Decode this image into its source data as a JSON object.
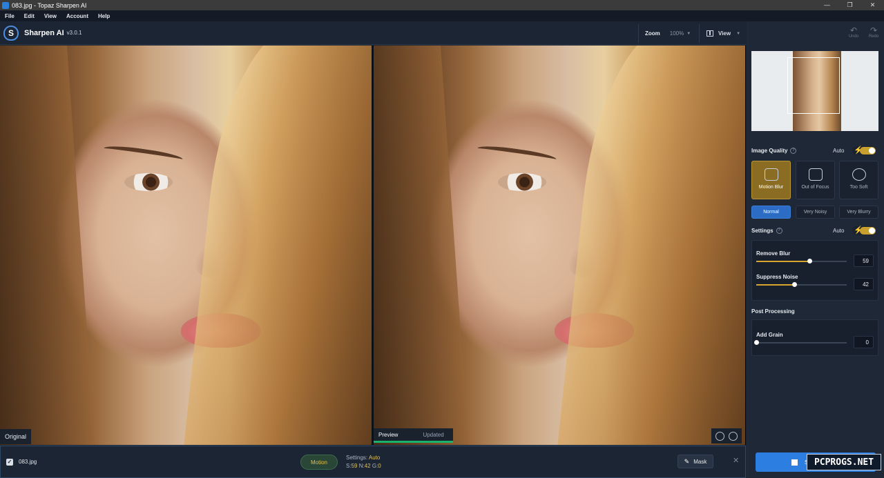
{
  "window": {
    "title": "083.jpg - Topaz Sharpen AI",
    "controls": [
      "—",
      "❐",
      "✕"
    ]
  },
  "menu": [
    "File",
    "Edit",
    "View",
    "Account",
    "Help"
  ],
  "header": {
    "app_name": "Sharpen AI",
    "version": "v3.0.1",
    "logo_letter": "S",
    "zoom_label": "Zoom",
    "zoom_value": "100%",
    "view_label": "View"
  },
  "history": {
    "undo": "Undo",
    "redo": "Redo"
  },
  "canvas": {
    "original_label": "Original",
    "preview_label": "Preview",
    "updated_label": "Updated"
  },
  "image_quality": {
    "title": "Image Quality",
    "auto_label": "Auto",
    "auto_enabled": true,
    "modes": [
      {
        "label": "Motion Blur",
        "active": true,
        "icon": "camera-shake-icon"
      },
      {
        "label": "Out of Focus",
        "active": false,
        "icon": "focus-person-icon"
      },
      {
        "label": "Too Soft",
        "active": false,
        "icon": "drop-icon"
      }
    ],
    "noise_levels": [
      {
        "label": "Normal",
        "active": true
      },
      {
        "label": "Very Noisy",
        "active": false
      },
      {
        "label": "Very Blurry",
        "active": false
      }
    ]
  },
  "settings": {
    "title": "Settings",
    "auto_label": "Auto",
    "auto_enabled": true,
    "sliders": [
      {
        "label": "Remove Blur",
        "value": "59",
        "fraction": 0.59
      },
      {
        "label": "Suppress Noise",
        "value": "42",
        "fraction": 0.42
      }
    ]
  },
  "post_processing": {
    "title": "Post Processing",
    "sliders": [
      {
        "label": "Add Grain",
        "value": "0",
        "fraction": 0
      }
    ]
  },
  "bottom": {
    "filename": "083.jpg",
    "checked": true,
    "mode_badge": "Motion",
    "settings_label": "Settings:",
    "settings_value": "Auto",
    "s_label": "S:",
    "s_value": "59",
    "n_label": "N:",
    "n_value": "42",
    "g_label": "G:",
    "g_value": "0",
    "mask_label": "Mask",
    "save_label": "S"
  },
  "watermark": "PCPROGS.NET",
  "colors": {
    "accent_gold": "#c8a02e",
    "accent_blue": "#2c7ee0",
    "preview_green": "#19b36b"
  }
}
